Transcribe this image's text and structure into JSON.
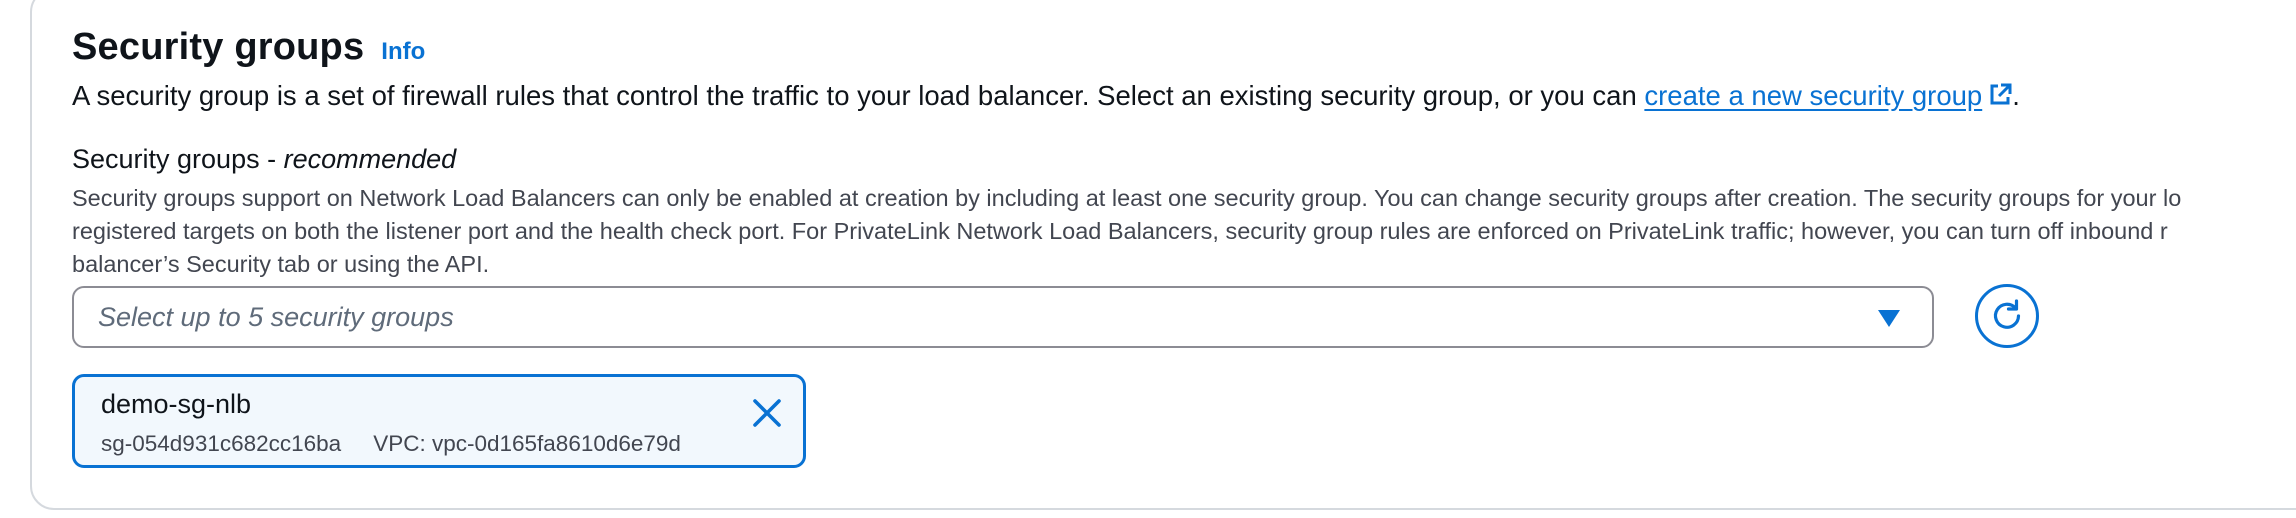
{
  "header": {
    "title": "Security groups",
    "info_label": "Info"
  },
  "description": {
    "text_before": "A security group is a set of firewall rules that control the traffic to your load balancer. Select an existing security group, or you can ",
    "link_text": "create a new security group",
    "text_after": "."
  },
  "field": {
    "label": "Security groups - ",
    "label_emphasis": "recommended",
    "constraint_lines": [
      "Security groups support on Network Load Balancers can only be enabled at creation by including at least one security group. You can change security groups after creation. The security groups for your lo",
      "registered targets on both the listener port and the health check port. For PrivateLink Network Load Balancers, security group rules are enforced on PrivateLink traffic; however, you can turn off inbound r",
      "balancer’s Security tab or using the API."
    ],
    "select_placeholder": "Select up to 5 security groups"
  },
  "selected_groups": [
    {
      "name": "demo-sg-nlb",
      "id": "sg-054d931c682cc16ba",
      "vpc": "VPC: vpc-0d165fa8610d6e79d"
    }
  ],
  "icons": {
    "external_link": "external-link-icon",
    "dropdown": "caret-down-icon",
    "refresh": "refresh-icon",
    "remove": "close-icon"
  },
  "colors": {
    "accent": "#0972d3",
    "text": "#0f141a",
    "secondary_text": "#424650",
    "placeholder": "#5f6b7a",
    "border": "#8c8c94",
    "token_background": "#f2f8fd"
  }
}
